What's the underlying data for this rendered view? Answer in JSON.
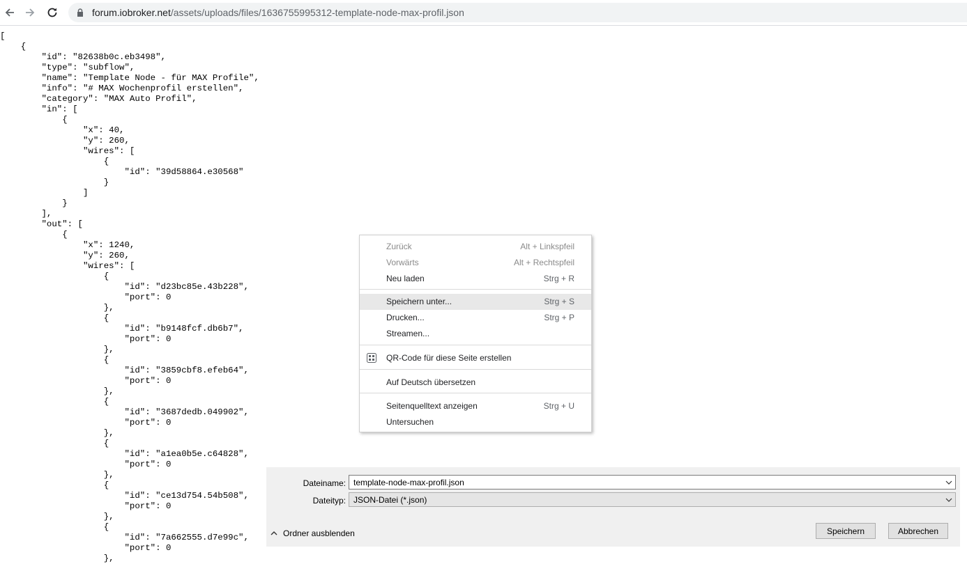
{
  "browser": {
    "url_host": "forum.iobroker.net",
    "url_path": "/assets/uploads/files/1636755995312-template-node-max-profil.json"
  },
  "json_text": "[\n    {\n        \"id\": \"82638b0c.eb3498\",\n        \"type\": \"subflow\",\n        \"name\": \"Template Node - für MAX Profile\",\n        \"info\": \"# MAX Wochenprofil erstellen\",\n        \"category\": \"MAX Auto Profil\",\n        \"in\": [\n            {\n                \"x\": 40,\n                \"y\": 260,\n                \"wires\": [\n                    {\n                        \"id\": \"39d58864.e30568\"\n                    }\n                ]\n            }\n        ],\n        \"out\": [\n            {\n                \"x\": 1240,\n                \"y\": 260,\n                \"wires\": [\n                    {\n                        \"id\": \"d23bc85e.43b228\",\n                        \"port\": 0\n                    },\n                    {\n                        \"id\": \"b9148fcf.db6b7\",\n                        \"port\": 0\n                    },\n                    {\n                        \"id\": \"3859cbf8.efeb64\",\n                        \"port\": 0\n                    },\n                    {\n                        \"id\": \"3687dedb.049902\",\n                        \"port\": 0\n                    },\n                    {\n                        \"id\": \"a1ea0b5e.c64828\",\n                        \"port\": 0\n                    },\n                    {\n                        \"id\": \"ce13d754.54b508\",\n                        \"port\": 0\n                    },\n                    {\n                        \"id\": \"7a662555.d7e99c\",\n                        \"port\": 0\n                    },",
  "context_menu": {
    "items": [
      {
        "label": "Zurück",
        "shortcut": "Alt + Linkspfeil"
      },
      {
        "label": "Vorwärts",
        "shortcut": "Alt + Rechtspfeil"
      },
      {
        "label": "Neu laden",
        "shortcut": "Strg + R"
      },
      {
        "label": "Speichern unter...",
        "shortcut": "Strg + S"
      },
      {
        "label": "Drucken...",
        "shortcut": "Strg + P"
      },
      {
        "label": "Streamen...",
        "shortcut": ""
      },
      {
        "label": "QR-Code für diese Seite erstellen",
        "shortcut": ""
      },
      {
        "label": "Auf Deutsch übersetzen",
        "shortcut": ""
      },
      {
        "label": "Seitenquelltext anzeigen",
        "shortcut": "Strg + U"
      },
      {
        "label": "Untersuchen",
        "shortcut": ""
      }
    ]
  },
  "save_dialog": {
    "filename_label": "Dateiname:",
    "filename_value": "template-node-max-profil.json",
    "filetype_label": "Dateityp:",
    "filetype_value": "JSON-Datei (*.json)",
    "hide_folders": "Ordner ausblenden",
    "save_button": "Speichern",
    "cancel_button": "Abbrechen"
  }
}
